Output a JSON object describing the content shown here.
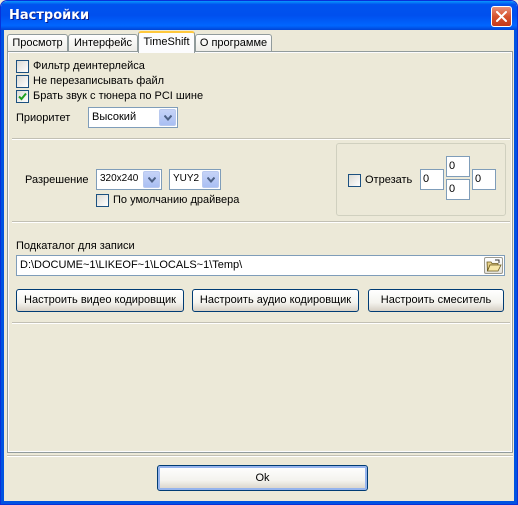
{
  "window": {
    "title": "Настройки",
    "close_icon": "close-icon"
  },
  "tabs": [
    {
      "label": "Просмотр",
      "active": false
    },
    {
      "label": "Интерфейс",
      "active": false
    },
    {
      "label": "TimeShift",
      "active": true
    },
    {
      "label": "О программе",
      "active": false
    }
  ],
  "general": {
    "deinterlace": {
      "label": "Фильтр деинтерлейса",
      "checked": false
    },
    "no_overwrite": {
      "label": "Не перезаписывать файл",
      "checked": false
    },
    "pci_audio": {
      "label": "Брать звук с тюнера по PCI шине",
      "checked": true
    },
    "priority_label": "Приоритет",
    "priority_value": "Высокий"
  },
  "resolution": {
    "label": "Разрешение",
    "size_value": "320x240",
    "format_value": "YUY2",
    "driver_default": {
      "label": "По умолчанию драйвера",
      "checked": false
    }
  },
  "crop": {
    "label": "Отрезать",
    "checked": false,
    "left": "0",
    "top": "0",
    "right": "0",
    "bottom": "0"
  },
  "recording": {
    "subfolder_label": "Подкаталог для записи",
    "path": "D:\\DOCUME~1\\LIKEOF~1\\LOCALS~1\\Temp\\",
    "video_encoder_btn": "Настроить видео кодировщик",
    "audio_encoder_btn": "Настроить аудио кодировщик",
    "mixer_btn": "Настроить смеситель"
  },
  "footer": {
    "ok_label": "Ok"
  },
  "colors": {
    "titlebar": "#0053ee",
    "face": "#ece9d8",
    "tab_active_accent": "#ffc83c",
    "close": "#d6532d"
  }
}
